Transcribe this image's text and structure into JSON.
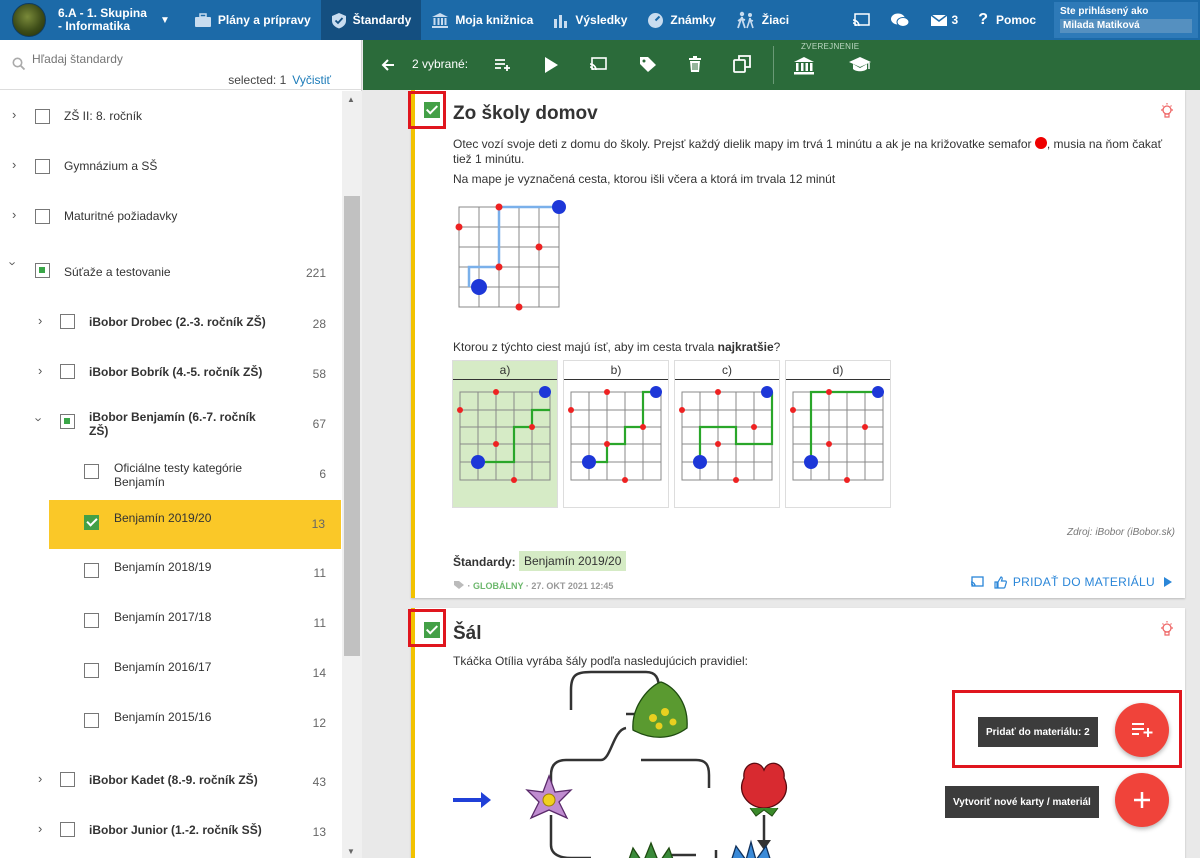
{
  "topbar": {
    "class_name_line1": "6.A - 1. Skupina",
    "class_name_line2": "- Informatika",
    "nav": [
      {
        "label": "Plány a prípravy",
        "icon": "briefcase-icon"
      },
      {
        "label": "Štandardy",
        "icon": "shield-icon"
      },
      {
        "label": "Moja knižnica",
        "icon": "library-icon"
      },
      {
        "label": "Výsledky",
        "icon": "bar-chart-icon"
      },
      {
        "label": "Známky",
        "icon": "gauge-icon"
      },
      {
        "label": "Žiaci",
        "icon": "students-icon"
      }
    ],
    "messages_count": "3",
    "help_label": "Pomoc",
    "logged_label": "Ste prihlásený ako",
    "user_name": "Milada Matiková"
  },
  "sidebar": {
    "search_placeholder": "Hľadaj štandardy",
    "selected_label": "selected: 1",
    "clear_label": "Vyčistiť",
    "items": [
      {
        "label": "ZŠ II: 8. ročník",
        "count": ""
      },
      {
        "label": "Gymnázium a SŠ",
        "count": ""
      },
      {
        "label": "Maturitné požiadavky",
        "count": ""
      },
      {
        "label": "Súťaže a testovanie",
        "count": "221"
      },
      {
        "label": "iBobor Drobec (2.-3. ročník ZŠ)",
        "count": "28"
      },
      {
        "label": "iBobor Bobrík (4.-5. ročník ZŠ)",
        "count": "58"
      },
      {
        "label": "iBobor Benjamín (6.-7. ročník ZŠ)",
        "count": "67"
      },
      {
        "label": "Oficiálne testy kategórie Benjamín",
        "count": "6"
      },
      {
        "label": "Benjamín 2019/20",
        "count": "13"
      },
      {
        "label": "Benjamín 2018/19",
        "count": "11"
      },
      {
        "label": "Benjamín 2017/18",
        "count": "11"
      },
      {
        "label": "Benjamín 2016/17",
        "count": "14"
      },
      {
        "label": "Benjamín 2015/16",
        "count": "12"
      },
      {
        "label": "iBobor Kadet (8.-9. ročník ZŠ)",
        "count": "43"
      },
      {
        "label": "iBobor Junior (1.-2. ročník SŠ)",
        "count": "13"
      }
    ]
  },
  "actionbar": {
    "selected_count": "2 vybrané:",
    "publish_label": "ZVEREJNENIE"
  },
  "card1": {
    "title": "Zo školy domov",
    "text1a": "Otec vozí svoje deti z domu do školy. Prejsť každý dielik mapy im trvá 1 minútu a ak je na križovatke semafor",
    "text1b": ", musia na ňom čakať tiež 1 minútu.",
    "text2": "Na mape je vyznačená cesta, ktorou išli včera a ktorá im trvala 12 minút",
    "question_a": "Ktorou z týchto ciest majú ísť, aby im cesta trvala ",
    "question_b": "najkratšie",
    "question_c": "?",
    "options": [
      "a)",
      "b)",
      "c)",
      "d)"
    ],
    "source": "Zdroj: iBobor (iBobor.sk)",
    "standards_label": "Štandardy:",
    "standard_tag": "Benjamín 2019/20",
    "meta_global": "GLOBÁLNY",
    "meta_date": "27. OKT 2021 12:45",
    "add_label": "PRIDAŤ DO MATERIÁLU"
  },
  "card2": {
    "title": "Šál",
    "text": "Tkáčka Otília vyrába šály podľa nasledujúcich pravidiel:"
  },
  "fab": {
    "add_tooltip": "Pridať do materiálu: 2",
    "create_tooltip": "Vytvoriť nové karty / materiál"
  }
}
